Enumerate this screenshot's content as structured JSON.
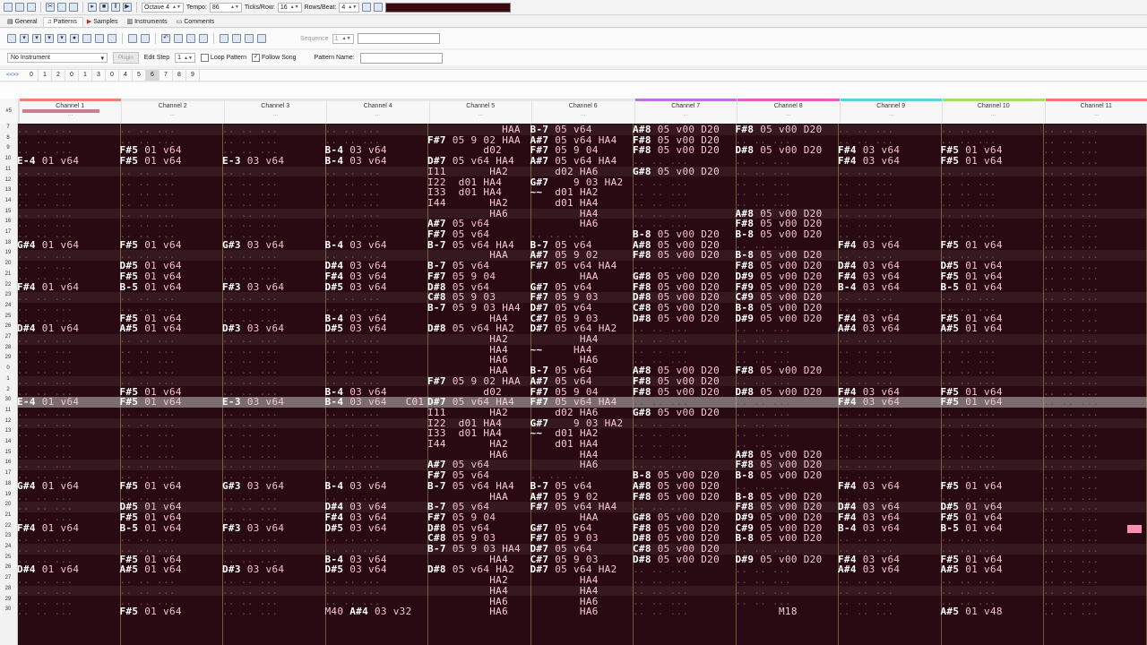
{
  "toolbar": {
    "octave_label": "Octave 4",
    "tempo_label": "Tempo:",
    "tempo_value": "86",
    "ticks_label": "Ticks/Row:",
    "ticks_value": "16",
    "rows_label": "Rows/Beat:",
    "rows_value": "4"
  },
  "tabs": [
    "General",
    "Patterns",
    "Samples",
    "Instruments",
    "Comments"
  ],
  "pattern_toolbar": {
    "sequence_label": "Sequence",
    "sequence_value": "1"
  },
  "instrument_bar": {
    "instrument": "No Instrument",
    "plugin_label": "Plugin",
    "edit_step_label": "Edit Step",
    "edit_step_value": "1",
    "loop_pattern": "Loop Pattern",
    "follow_song": "Follow Song",
    "pattern_name_label": "Pattern Name:"
  },
  "order": {
    "nav": "<<>>",
    "items": [
      "0",
      "1",
      "2",
      "0",
      "1",
      "3",
      "0",
      "4",
      "5",
      "6",
      "7",
      "8",
      "9"
    ],
    "selected_index": 9
  },
  "pattern_header": {
    "pattern_number": "#5",
    "channels": [
      {
        "name": "Channel 1",
        "color": "#f08070"
      },
      {
        "name": "Channel 2",
        "color": "#e6e6e6"
      },
      {
        "name": "Channel 3",
        "color": "#e6e6e6"
      },
      {
        "name": "Channel 4",
        "color": "#e6e6e6"
      },
      {
        "name": "Channel 5",
        "color": "#e6e6e6"
      },
      {
        "name": "Channel 6",
        "color": "#e6e6e6"
      },
      {
        "name": "Channel 7",
        "color": "#c070e0"
      },
      {
        "name": "Channel 8",
        "color": "#e060c0"
      },
      {
        "name": "Channel 9",
        "color": "#60d0e0"
      },
      {
        "name": "Channel 10",
        "color": "#a0e070"
      },
      {
        "name": "Channel 11",
        "color": "#ff7070"
      }
    ]
  },
  "rows": [
    {
      "num": "7",
      "cells": [
        "",
        "",
        "",
        "",
        "            HAA",
        "B-7 05 v64",
        "A#8 05 v00 D20",
        "F#8 05 v00 D20",
        "",
        "",
        ""
      ]
    },
    {
      "num": "8",
      "cells": [
        "",
        "",
        "",
        "",
        "F#7 05 9 02 HAA",
        "A#7 05 v64 HA4",
        "F#8 05 v00 D20",
        "",
        "",
        "",
        ""
      ]
    },
    {
      "num": "9",
      "cells": [
        "",
        "F#5 01 v64",
        "",
        "B-4 03 v64",
        "         d02",
        "F#7 05 9 04",
        "F#8 05 v00 D20",
        "D#8 05 v00 D20",
        "F#4 03 v64",
        "F#5 01 v64",
        ""
      ]
    },
    {
      "num": "10",
      "cells": [
        "E-4 01 v64",
        "F#5 01 v64",
        "E-3 03 v64",
        "B-4 03 v64",
        "D#7 05 v64 HA4",
        "A#7 05 v64 HA4",
        "",
        "",
        "F#4 03 v64",
        "F#5 01 v64",
        ""
      ]
    },
    {
      "num": "11",
      "cells": [
        "",
        "",
        "",
        "",
        "I11       HA2",
        "    d02 HA6",
        "G#8 05 v00 D20",
        "",
        "",
        "",
        ""
      ]
    },
    {
      "num": "12",
      "cells": [
        "",
        "",
        "",
        "",
        "I22  d01 HA4",
        "G#7    9 03 HA2",
        "",
        "",
        "",
        "",
        ""
      ]
    },
    {
      "num": "13",
      "cells": [
        "",
        "",
        "",
        "",
        "I33  d01 HA4",
        "~~  d01 HA2",
        "",
        "",
        "",
        "",
        ""
      ]
    },
    {
      "num": "14",
      "cells": [
        "",
        "",
        "",
        "",
        "I44       HA2",
        "    d01 HA4",
        "",
        "",
        "",
        "",
        ""
      ]
    },
    {
      "num": "15",
      "cells": [
        "",
        "",
        "",
        "",
        "          HA6",
        "        HA4",
        "",
        "A#8 05 v00 D20",
        "",
        "",
        ""
      ]
    },
    {
      "num": "16",
      "cells": [
        "",
        "",
        "",
        "",
        "A#7 05 v64",
        "        HA6",
        "",
        "F#8 05 v00 D20",
        "",
        "",
        ""
      ]
    },
    {
      "num": "17",
      "cells": [
        "",
        "",
        "",
        "",
        "F#7 05 v64",
        "",
        "B-8 05 v00 D20",
        "B-8 05 v00 D20",
        "",
        "",
        ""
      ]
    },
    {
      "num": "18",
      "cells": [
        "G#4 01 v64",
        "F#5 01 v64",
        "G#3 03 v64",
        "B-4 03 v64",
        "B-7 05 v64 HA4",
        "B-7 05 v64",
        "A#8 05 v00 D20",
        "",
        "F#4 03 v64",
        "F#5 01 v64",
        ""
      ]
    },
    {
      "num": "19",
      "cells": [
        "",
        "",
        "",
        "",
        "          HAA",
        "A#7 05 9 02",
        "F#8 05 v00 D20",
        "B-8 05 v00 D20",
        "",
        "",
        ""
      ]
    },
    {
      "num": "20",
      "cells": [
        "",
        "D#5 01 v64",
        "",
        "D#4 03 v64",
        "B-7 05 v64",
        "F#7 05 v64 HA4",
        "",
        "F#8 05 v00 D20",
        "D#4 03 v64",
        "D#5 01 v64",
        ""
      ]
    },
    {
      "num": "21",
      "cells": [
        "",
        "F#5 01 v64",
        "",
        "F#4 03 v64",
        "F#7 05 9 04",
        "        HAA",
        "G#8 05 v00 D20",
        "D#9 05 v00 D20",
        "F#4 03 v64",
        "F#5 01 v64",
        ""
      ]
    },
    {
      "num": "22",
      "cells": [
        "F#4 01 v64",
        "B-5 01 v64",
        "F#3 03 v64",
        "D#5 03 v64",
        "D#8 05 v64",
        "G#7 05 v64",
        "F#8 05 v00 D20",
        "F#9 05 v00 D20",
        "B-4 03 v64",
        "B-5 01 v64",
        ""
      ]
    },
    {
      "num": "23",
      "cells": [
        "",
        "",
        "",
        "",
        "C#8 05 9 03",
        "F#7 05 9 03",
        "D#8 05 v00 D20",
        "C#9 05 v00 D20",
        "",
        "",
        ""
      ]
    },
    {
      "num": "24",
      "cells": [
        "",
        "",
        "",
        "",
        "B-7 05 9 03 HA4",
        "D#7 05 v64",
        "C#8 05 v00 D20",
        "B-8 05 v00 D20",
        "",
        "",
        ""
      ]
    },
    {
      "num": "25",
      "cells": [
        "",
        "F#5 01 v64",
        "",
        "B-4 03 v64",
        "          HA4",
        "C#7 05 9 03",
        "D#8 05 v00 D20",
        "D#9 05 v00 D20",
        "F#4 03 v64",
        "F#5 01 v64",
        ""
      ]
    },
    {
      "num": "26",
      "cells": [
        "D#4 01 v64",
        "A#5 01 v64",
        "D#3 03 v64",
        "D#5 03 v64",
        "D#8 05 v64 HA2",
        "D#7 05 v64 HA2",
        "",
        "",
        "A#4 03 v64",
        "A#5 01 v64",
        ""
      ]
    },
    {
      "num": "27",
      "cells": [
        "",
        "",
        "",
        "",
        "          HA2",
        "        HA4",
        "",
        "",
        "",
        "",
        ""
      ]
    },
    {
      "num": "28",
      "cells": [
        "",
        "",
        "",
        "",
        "          HA4",
        "~~     HA4",
        "",
        "",
        "",
        "",
        ""
      ]
    },
    {
      "num": "29",
      "cells": [
        "",
        "",
        "",
        "",
        "          HA6",
        "        HA6",
        "",
        "",
        "",
        "",
        ""
      ]
    },
    {
      "num": "0",
      "cells": [
        "",
        "",
        "",
        "",
        "          HAA",
        "B-7 05 v64",
        "A#8 05 v00 D20",
        "F#8 05 v00 D20",
        "",
        "",
        ""
      ]
    },
    {
      "num": "1",
      "cells": [
        "",
        "",
        "",
        "",
        "F#7 05 9 02 HAA",
        "A#7 05 v64",
        "F#8 05 v00 D20",
        "",
        "",
        "",
        ""
      ]
    },
    {
      "num": "2",
      "cells": [
        "",
        "F#5 01 v64",
        "",
        "B-4 03 v64",
        "         d02",
        "F#7 05 9 04",
        "F#8 05 v00 D20",
        "D#8 05 v00 D20",
        "F#4 03 v64",
        "F#5 01 v64",
        ""
      ]
    },
    {
      "num": "30",
      "cells": [
        "E-4 01 v64",
        "F#5 01 v64",
        "E-3 03 v64",
        "B-4 03 v64   C01",
        "D#7 05 v64 HA4",
        "F#7 05 v64 HA4",
        "",
        "",
        "F#4 03 v64",
        "F#5 01 v64",
        ""
      ],
      "current": true
    },
    {
      "num": "11",
      "cells": [
        "",
        "",
        "",
        "",
        "I11       HA2",
        "    d02 HA6",
        "G#8 05 v00 D20",
        "",
        "",
        "",
        ""
      ]
    },
    {
      "num": "12",
      "cells": [
        "",
        "",
        "",
        "",
        "I22  d01 HA4",
        "G#7    9 03 HA2",
        "",
        "",
        "",
        "",
        ""
      ]
    },
    {
      "num": "13",
      "cells": [
        "",
        "",
        "",
        "",
        "I33  d01 HA4",
        "~~  d01 HA2",
        "",
        "",
        "",
        "",
        ""
      ]
    },
    {
      "num": "14",
      "cells": [
        "",
        "",
        "",
        "",
        "I44       HA2",
        "    d01 HA4",
        "",
        "",
        "",
        "",
        ""
      ]
    },
    {
      "num": "15",
      "cells": [
        "",
        "",
        "",
        "",
        "          HA6",
        "        HA4",
        "",
        "A#8 05 v00 D20",
        "",
        "",
        ""
      ]
    },
    {
      "num": "16",
      "cells": [
        "",
        "",
        "",
        "",
        "A#7 05 v64",
        "        HA6",
        "",
        "F#8 05 v00 D20",
        "",
        "",
        ""
      ]
    },
    {
      "num": "17",
      "cells": [
        "",
        "",
        "",
        "",
        "F#7 05 v64",
        "",
        "B-8 05 v00 D20",
        "B-8 05 v00 D20",
        "",
        "",
        ""
      ]
    },
    {
      "num": "18",
      "cells": [
        "G#4 01 v64",
        "F#5 01 v64",
        "G#3 03 v64",
        "B-4 03 v64",
        "B-7 05 v64 HA4",
        "B-7 05 v64",
        "A#8 05 v00 D20",
        "",
        "F#4 03 v64",
        "F#5 01 v64",
        ""
      ]
    },
    {
      "num": "19",
      "cells": [
        "",
        "",
        "",
        "",
        "          HAA",
        "A#7 05 9 02",
        "F#8 05 v00 D20",
        "B-8 05 v00 D20",
        "",
        "",
        ""
      ]
    },
    {
      "num": "20",
      "cells": [
        "",
        "D#5 01 v64",
        "",
        "D#4 03 v64",
        "B-7 05 v64",
        "F#7 05 v64 HA4",
        "",
        "F#8 05 v00 D20",
        "D#4 03 v64",
        "D#5 01 v64",
        ""
      ]
    },
    {
      "num": "21",
      "cells": [
        "",
        "F#5 01 v64",
        "",
        "F#4 03 v64",
        "F#7 05 9 04",
        "        HAA",
        "G#8 05 v00 D20",
        "D#9 05 v00 D20",
        "F#4 03 v64",
        "F#5 01 v64",
        ""
      ]
    },
    {
      "num": "22",
      "cells": [
        "F#4 01 v64",
        "B-5 01 v64",
        "F#3 03 v64",
        "D#5 03 v64",
        "D#8 05 v64",
        "G#7 05 v64",
        "F#8 05 v00 D20",
        "C#9 05 v00 D20",
        "B-4 03 v64",
        "B-5 01 v64",
        ""
      ]
    },
    {
      "num": "23",
      "cells": [
        "",
        "",
        "",
        "",
        "C#8 05 9 03",
        "F#7 05 9 03",
        "D#8 05 v00 D20",
        "B-8 05 v00 D20",
        "",
        "",
        ""
      ]
    },
    {
      "num": "24",
      "cells": [
        "",
        "",
        "",
        "",
        "B-7 05 9 03 HA4",
        "D#7 05 v64",
        "C#8 05 v00 D20",
        "",
        "",
        "",
        ""
      ]
    },
    {
      "num": "25",
      "cells": [
        "",
        "F#5 01 v64",
        "",
        "B-4 03 v64",
        "          HA4",
        "C#7 05 9 03",
        "D#8 05 v00 D20",
        "D#9 05 v00 D20",
        "F#4 03 v64",
        "F#5 01 v64",
        ""
      ]
    },
    {
      "num": "26",
      "cells": [
        "D#4 01 v64",
        "A#5 01 v64",
        "D#3 03 v64",
        "D#5 03 v64",
        "D#8 05 v64 HA2",
        "D#7 05 v64 HA2",
        "",
        "",
        "A#4 03 v64",
        "A#5 01 v64",
        ""
      ]
    },
    {
      "num": "27",
      "cells": [
        "",
        "",
        "",
        "",
        "          HA2",
        "        HA4",
        "",
        "",
        "",
        "",
        ""
      ]
    },
    {
      "num": "28",
      "cells": [
        "",
        "",
        "",
        "",
        "          HA4",
        "        HA4",
        "",
        "",
        "",
        "",
        ""
      ]
    },
    {
      "num": "29",
      "cells": [
        "",
        "",
        "",
        "",
        "          HA6",
        "        HA6",
        "",
        "",
        "",
        "",
        ""
      ]
    },
    {
      "num": "30",
      "cells": [
        "",
        "F#5 01 v64",
        "",
        "M40 A#4 03 v32",
        "          HA6",
        "        HA6",
        "",
        "       M18",
        "",
        "A#5 01 v48",
        ""
      ]
    }
  ]
}
